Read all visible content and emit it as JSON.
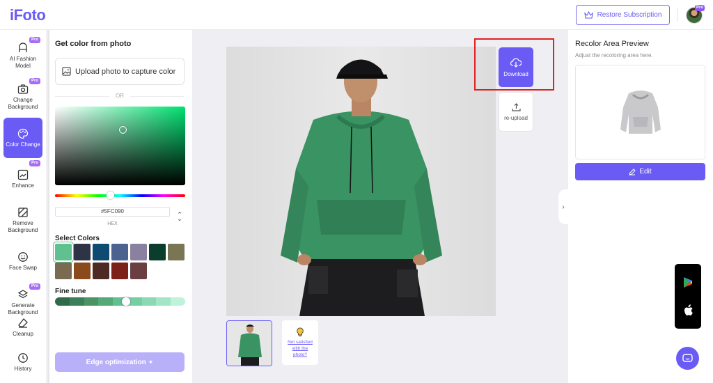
{
  "header": {
    "logo": "iFoto",
    "restore_label": "Restore Subscription",
    "avatar_badge": "Pro"
  },
  "sidebar": {
    "items": [
      {
        "label": "AI Fashion Model",
        "icon": "hanger-icon",
        "pro": "Pro"
      },
      {
        "label": "Change Background",
        "icon": "camera-icon",
        "pro": "Pro"
      },
      {
        "label": "Color Change",
        "icon": "palette-icon",
        "active": true
      },
      {
        "label": "Enhance",
        "icon": "enhance-icon",
        "pro": "Pro"
      },
      {
        "label": "Remove Background",
        "icon": "crop-icon"
      },
      {
        "label": "Face Swap",
        "icon": "face-swap-icon"
      },
      {
        "label": "Generate Background",
        "icon": "layers-icon",
        "pro": "Pro"
      },
      {
        "label": "Cleanup",
        "icon": "eraser-icon"
      },
      {
        "label": "History",
        "icon": "clock-icon"
      }
    ]
  },
  "panel": {
    "title": "Get color from photo",
    "upload_label": "Upload photo to capture color",
    "or_label": "OR",
    "hex_value": "#5FC090",
    "hex_label": "HEX",
    "select_colors_title": "Select Colors",
    "swatches": [
      "#5fc090",
      "#2e3346",
      "#0f4a73",
      "#4b638e",
      "#8a81a0",
      "#0b3d2c",
      "#7a7553",
      "#7b6a52",
      "#8b4a1c",
      "#4e2a24",
      "#7c2218",
      "#6b3f42"
    ],
    "fine_tune_title": "Fine tune",
    "fine_tune_colors": [
      "#2f6b4b",
      "#3b8058",
      "#4b9466",
      "#55a877",
      "#5fc090",
      "#75cfa2",
      "#8ad9b3",
      "#a3e6c6",
      "#bff2da"
    ],
    "edge_label": "Edge optimization"
  },
  "canvas": {
    "download_label": "Download",
    "reupload_label": "re-upload",
    "help_text": "Not satisfied with the photo?"
  },
  "right_panel": {
    "title": "Recolor Area Preview",
    "subtitle": "Adjust the recoloring area here.",
    "edit_label": "Edit"
  },
  "colors": {
    "accent": "#6a5bf5",
    "hoodie": "#3a9362",
    "highlight": "#e02020"
  }
}
